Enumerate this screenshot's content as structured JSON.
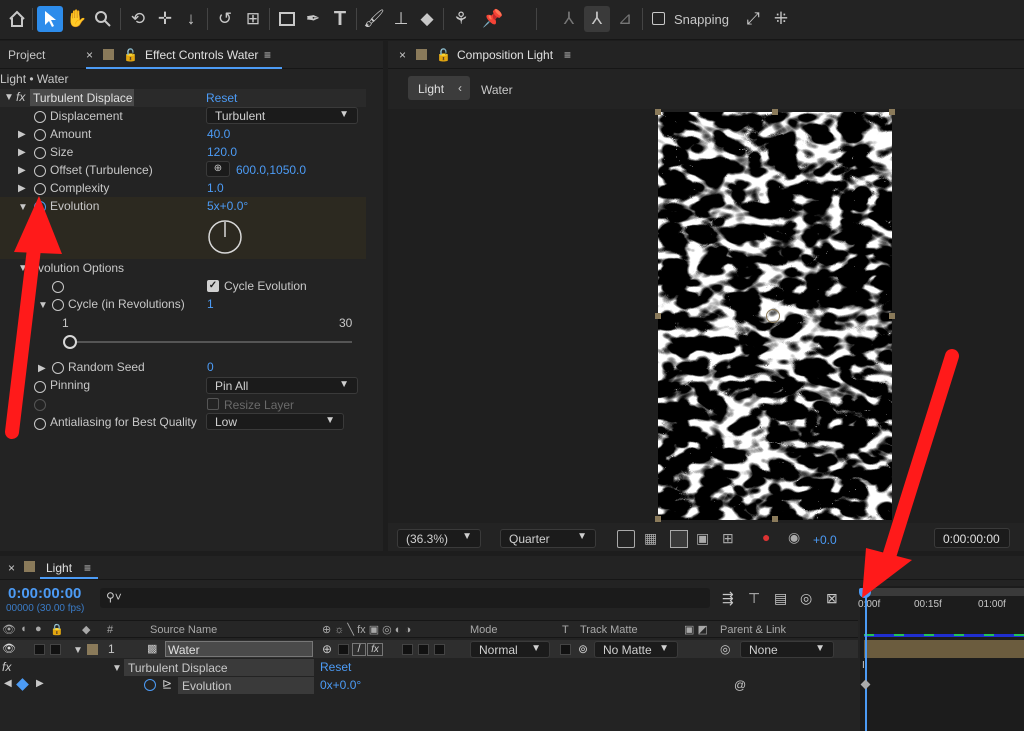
{
  "toolbar": {
    "snapping_label": "Snapping",
    "tools": [
      "home-icon",
      "selection-icon",
      "hand-icon",
      "zoom-icon",
      "orbit-icon",
      "move-icon",
      "dolly-icon",
      "rotate-icon",
      "pan-behind-icon",
      "rectangle-icon",
      "pen-icon",
      "type-icon",
      "brush-icon",
      "clone-stamp-icon",
      "eraser-icon",
      "roto-brush-icon",
      "puppet-pin-icon"
    ],
    "active_tool": "selection-icon"
  },
  "effect_controls": {
    "project_tab": "Project",
    "tab_title": "Effect Controls Water",
    "breadcrumb": "Light • Water",
    "effect_name": "Turbulent Displace",
    "reset": "Reset",
    "properties": [
      {
        "name": "Displacement",
        "value": "Turbulent",
        "kind": "dropdown"
      },
      {
        "name": "Amount",
        "value": "40.0",
        "kind": "number"
      },
      {
        "name": "Size",
        "value": "120.0",
        "kind": "number"
      },
      {
        "name": "Offset (Turbulence)",
        "value": "600.0,1050.0",
        "kind": "point"
      },
      {
        "name": "Complexity",
        "value": "1.0",
        "kind": "number"
      },
      {
        "name": "Evolution",
        "value": "5x+0.0°",
        "kind": "angle"
      }
    ],
    "evolution_options": {
      "label": "Evolution Options",
      "cycle_evolution_label": "Cycle Evolution",
      "cycle_evolution_checked": true,
      "cycle_label": "Cycle (in Revolutions)",
      "cycle_value": "1",
      "slider_min": "1",
      "slider_max": "30",
      "slider_fraction": 0,
      "random_seed_label": "Random Seed",
      "random_seed_value": "0"
    },
    "pinning_label": "Pinning",
    "pinning_value": "Pin All",
    "resize_layer_label": "Resize Layer",
    "antialiasing_label": "Antialiasing for Best Quality",
    "antialiasing_value": "Low"
  },
  "composition": {
    "tab_title": "Composition Light",
    "crumb_light": "Light",
    "crumb_water": "Water",
    "zoom": "(36.3%)",
    "resolution": "Quarter",
    "exposure": "+0.0",
    "timecode": "0:00:00:00"
  },
  "timeline": {
    "tab_title": "Light",
    "timecode": "0:00:00:00",
    "frames": "00000 (30.00 fps)",
    "search_placeholder": "",
    "columns": {
      "num": "#",
      "source_name": "Source Name",
      "mode": "Mode",
      "t": "T",
      "track_matte": "Track Matte",
      "parent": "Parent & Link"
    },
    "layer": {
      "index": "1",
      "name": "Water",
      "mode": "Normal",
      "matte": "No Matte",
      "parent": "None"
    },
    "effect_row": {
      "name": "Turbulent Displace",
      "reset": "Reset"
    },
    "property_row": {
      "name": "Evolution",
      "value": "0x+0.0°"
    },
    "ruler": [
      "0:00f",
      "00:15f",
      "01:00f"
    ]
  },
  "colors": {
    "accent_blue": "#4c9bf5",
    "arrow_red": "#ff1a1a",
    "panel_bg": "#232323"
  }
}
